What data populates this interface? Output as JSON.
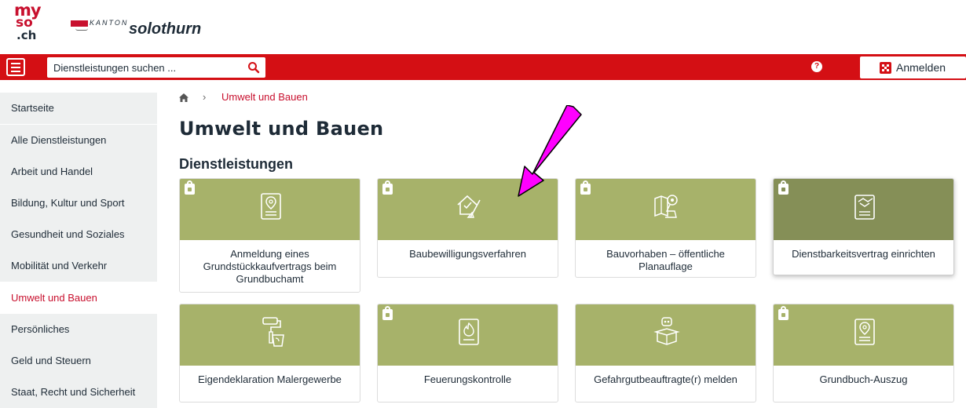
{
  "header": {
    "logo_line1": "my",
    "logo_line2": "so",
    "logo_line3": ".ch",
    "kanton_label": "KANTON",
    "kanton_name": "solothurn"
  },
  "bar": {
    "search_placeholder": "Dienstleistungen suchen ...",
    "help_label": "?",
    "login_label": "Anmelden"
  },
  "sidebar": {
    "items": [
      {
        "label": "Startseite",
        "active": false
      },
      {
        "label": "Alle Dienstleistungen",
        "active": false
      },
      {
        "label": "Arbeit und Handel",
        "active": false
      },
      {
        "label": "Bildung, Kultur und Sport",
        "active": false
      },
      {
        "label": "Gesundheit und Soziales",
        "active": false
      },
      {
        "label": "Mobilität und Verkehr",
        "active": false
      },
      {
        "label": "Umwelt und Bauen",
        "active": true
      },
      {
        "label": "Persönliches",
        "active": false
      },
      {
        "label": "Geld und Steuern",
        "active": false
      },
      {
        "label": "Staat, Recht und Sicherheit",
        "active": false
      }
    ]
  },
  "breadcrumb": {
    "separator": "›",
    "current": "Umwelt und Bauen"
  },
  "main": {
    "title": "Umwelt und Bauen",
    "section_title": "Dienstleistungen",
    "cards": [
      {
        "label": "Anmeldung eines Grundstückkaufvertrags beim Grundbuchamt",
        "locked": true,
        "icon": "document-location-icon"
      },
      {
        "label": "Baubewilligungsverfahren",
        "locked": true,
        "icon": "house-plan-icon"
      },
      {
        "label": "Bauvorhaben – öffentliche Planauflage",
        "locked": true,
        "icon": "map-view-icon"
      },
      {
        "label": "Dienstbarkeitsvertrag einrichten",
        "locked": true,
        "icon": "contract-handshake-icon"
      },
      {
        "label": "Eigendeklaration Malergewerbe",
        "locked": false,
        "icon": "paint-roller-icon"
      },
      {
        "label": "Feuerungskontrolle",
        "locked": true,
        "icon": "fire-document-icon"
      },
      {
        "label": "Gefahrgutbeauftragte(r) melden",
        "locked": false,
        "icon": "hazard-box-icon"
      },
      {
        "label": "Grundbuch-Auszug",
        "locked": true,
        "icon": "document-location-icon"
      }
    ]
  },
  "colors": {
    "brand_red": "#d40f14",
    "card_green": "#a7b26a",
    "card_green_hover": "#858f57",
    "annotation_arrow": "#ff00ff"
  }
}
